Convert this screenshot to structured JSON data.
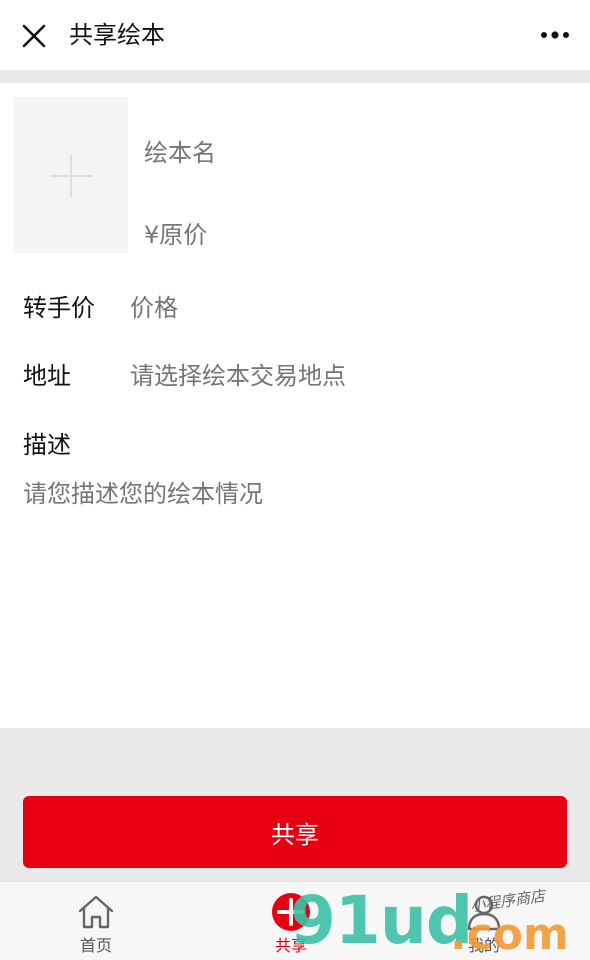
{
  "nav": {
    "title": "共享绘本",
    "close_icon": "close-icon",
    "more_icon": "more-dots-icon"
  },
  "form": {
    "cover_icon": "plus-icon",
    "name_placeholder": "绘本名",
    "original_price_placeholder": "¥原价",
    "resale_label": "转手价",
    "resale_placeholder": "价格",
    "address_label": "地址",
    "address_placeholder": "请选择绘本交易地点",
    "desc_label": "描述",
    "desc_placeholder": "请您描述您的绘本情况"
  },
  "share_button_label": "共享",
  "tab_bar": {
    "items": [
      {
        "label": "首页",
        "icon": "home-icon",
        "active": false
      },
      {
        "label": "共享",
        "icon": "add-circle-icon",
        "active": true
      },
      {
        "label": "我的",
        "icon": "user-icon",
        "active": false
      }
    ]
  },
  "watermark": {
    "main": "91ud",
    "suffix": ".com",
    "stamp": "小程序商店"
  },
  "colors": {
    "accent": "#e60012",
    "background": "#e9e9e9",
    "placeholder": "#999999"
  }
}
